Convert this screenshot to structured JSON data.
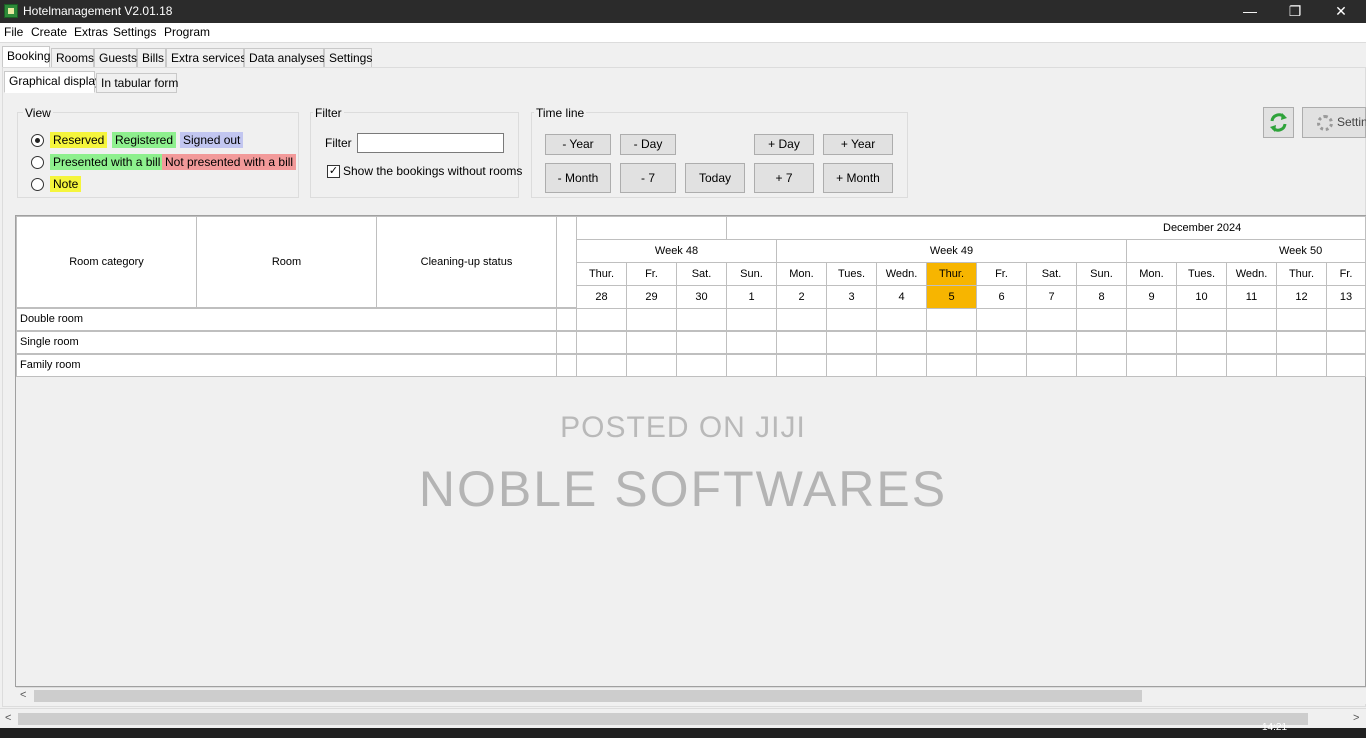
{
  "window": {
    "title": "Hotelmanagement V2.01.18",
    "controls": {
      "minimize": "—",
      "maximize": "❐",
      "close": "✕"
    }
  },
  "menu": [
    "File",
    "Create",
    "Extras",
    "Settings",
    "Program"
  ],
  "main_tabs": [
    "Booking",
    "Rooms",
    "Guests",
    "Bills",
    "Extra services",
    "Data analyses",
    "Settings"
  ],
  "sub_tabs": [
    "Graphical display",
    "In tabular form"
  ],
  "view": {
    "title": "View",
    "options": [
      {
        "label": "Reserved",
        "color": "#f5f53c"
      },
      {
        "label": "Registered",
        "color": "#8ef08e"
      },
      {
        "label": "Signed out",
        "color": "#c2c6f0"
      },
      {
        "label": "Presented with a bill",
        "color": "#8ef08e"
      },
      {
        "label": "Not presented with a bill",
        "color": "#f29a9a"
      },
      {
        "label": "Note",
        "color": "#f5f53c"
      }
    ]
  },
  "filter": {
    "title": "Filter",
    "label": "Filter",
    "value": "",
    "checkbox_label": "Show the bookings without rooms",
    "checkbox_checked": true
  },
  "timeline": {
    "title": "Time line",
    "buttons": {
      "minus_year": "- Year",
      "minus_day": "- Day",
      "plus_day": "+ Day",
      "plus_year": "+ Year",
      "minus_month": "- Month",
      "minus_7": "- 7",
      "today": "Today",
      "plus_7": "+ 7",
      "plus_month": "+ Month"
    }
  },
  "toolbar": {
    "settings_label": "Settin",
    "refresh_icon": "refresh-icon",
    "gear_icon": "gear-icon"
  },
  "grid": {
    "columns": {
      "category": "Room category",
      "room": "Room",
      "cleaning": "Cleaning-up status"
    },
    "month": "December 2024",
    "weeks": [
      "Week 48",
      "Week 49",
      "Week 50"
    ],
    "days": [
      {
        "dow": "Thur.",
        "day": "28"
      },
      {
        "dow": "Fr.",
        "day": "29"
      },
      {
        "dow": "Sat.",
        "day": "30"
      },
      {
        "dow": "Sun.",
        "day": "1"
      },
      {
        "dow": "Mon.",
        "day": "2"
      },
      {
        "dow": "Tues.",
        "day": "3"
      },
      {
        "dow": "Wedn.",
        "day": "4"
      },
      {
        "dow": "Thur.",
        "day": "5",
        "today": true
      },
      {
        "dow": "Fr.",
        "day": "6"
      },
      {
        "dow": "Sat.",
        "day": "7"
      },
      {
        "dow": "Sun.",
        "day": "8"
      },
      {
        "dow": "Mon.",
        "day": "9"
      },
      {
        "dow": "Tues.",
        "day": "10"
      },
      {
        "dow": "Wedn.",
        "day": "11"
      },
      {
        "dow": "Thur.",
        "day": "12"
      },
      {
        "dow": "Fr.",
        "day": "13"
      }
    ],
    "rows": [
      "Double room",
      "Single room",
      "Family room"
    ],
    "today_color": "#f7b500"
  },
  "watermark": {
    "line1": "POSTED ON JIJI",
    "line2": "NOBLE SOFTWARES"
  },
  "taskbar": {
    "clock": "14:21"
  }
}
